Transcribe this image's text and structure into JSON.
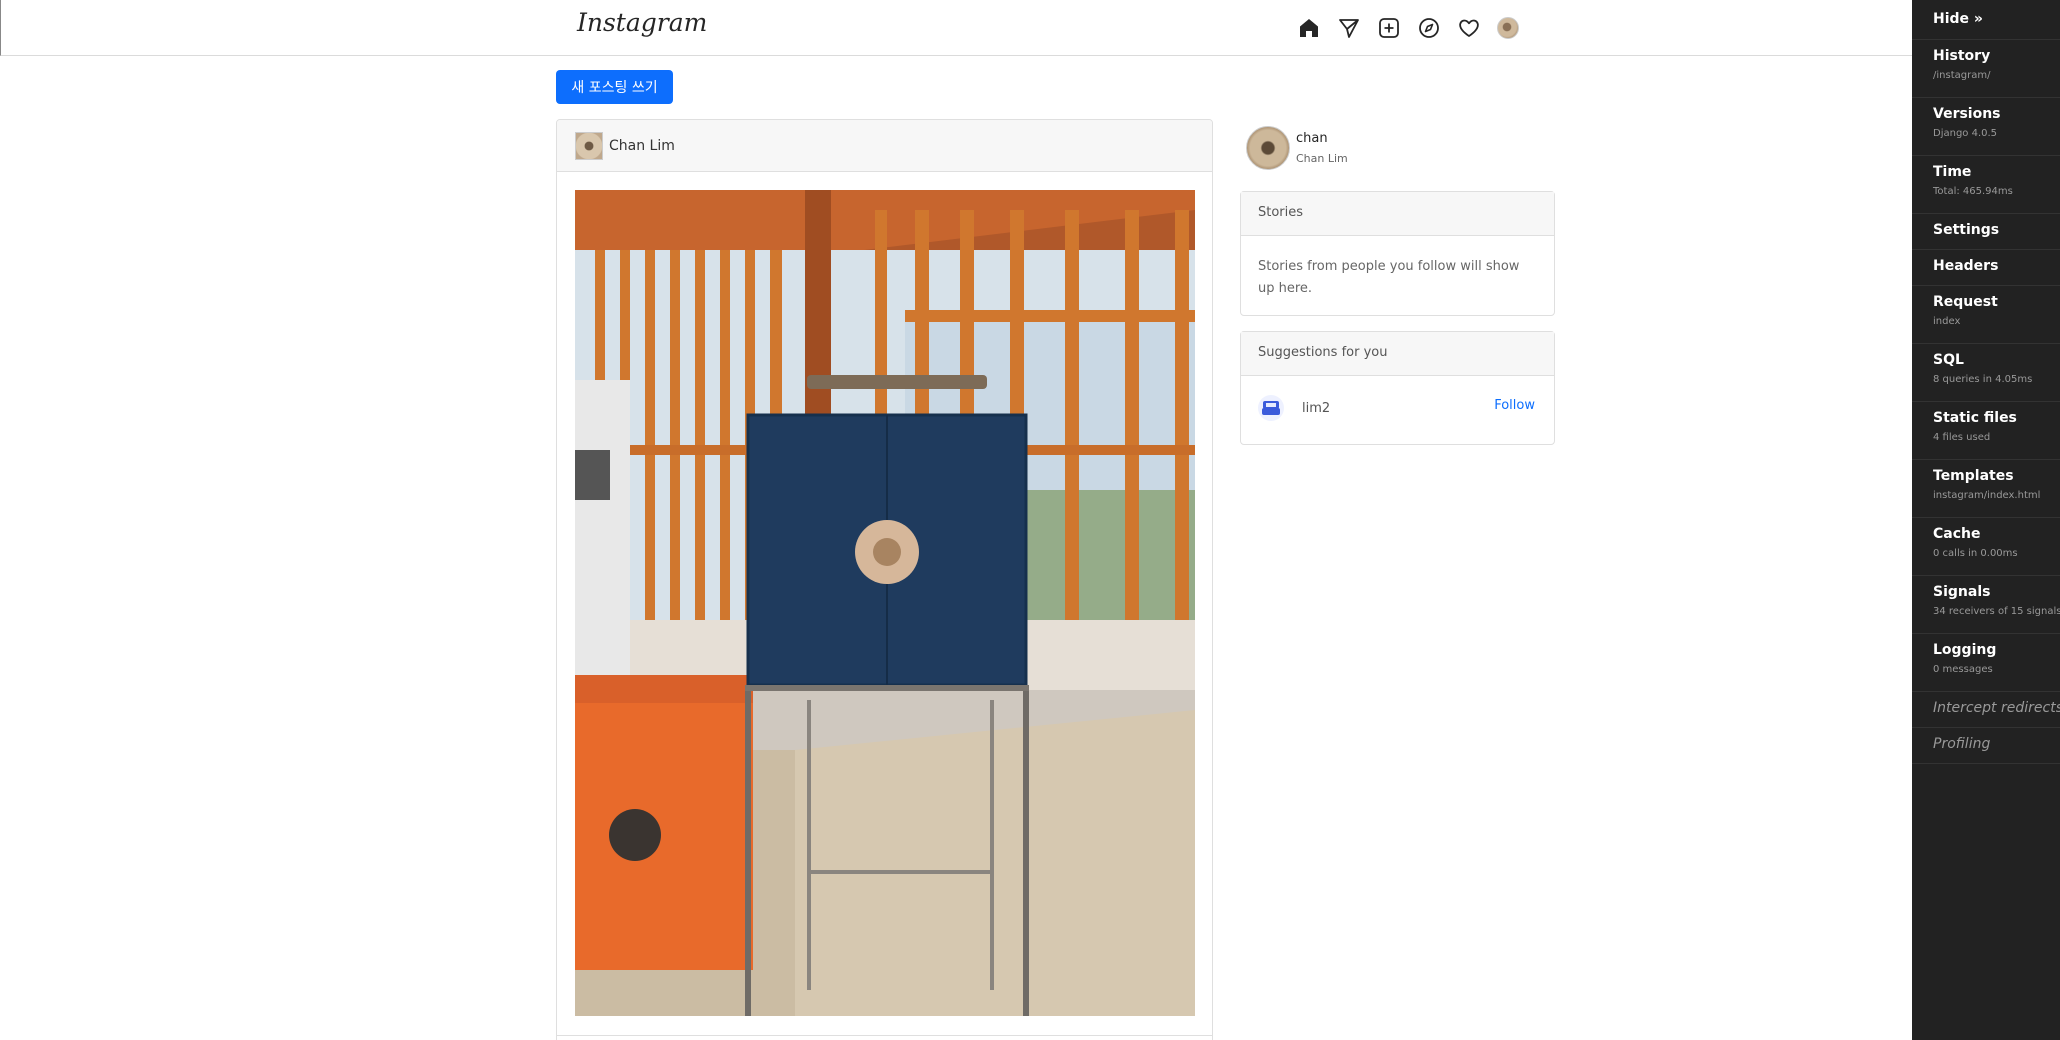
{
  "header": {
    "logo": "Instagram",
    "icons": [
      "home-icon",
      "send-icon",
      "add-post-icon",
      "explore-icon",
      "heart-icon",
      "avatar"
    ]
  },
  "actions": {
    "new_post_label": "새 포스팅 쓰기"
  },
  "post": {
    "author": "Chan Lim"
  },
  "sidebar": {
    "username": "chan",
    "full_name": "Chan Lim",
    "stories": {
      "title": "Stories",
      "body": "Stories from people you follow will show up here."
    },
    "suggestions": {
      "title": "Suggestions for you",
      "items": [
        {
          "username": "lim2",
          "action": "Follow"
        }
      ]
    }
  },
  "debug_toolbar": {
    "hide_label": "Hide »",
    "panels": [
      {
        "title": "History",
        "subtitle": "/instagram/"
      },
      {
        "title": "Versions",
        "subtitle": "Django 4.0.5"
      },
      {
        "title": "Time",
        "subtitle": "Total: 465.94ms"
      },
      {
        "title": "Settings",
        "subtitle": ""
      },
      {
        "title": "Headers",
        "subtitle": ""
      },
      {
        "title": "Request",
        "subtitle": "index"
      },
      {
        "title": "SQL",
        "subtitle": "8 queries in 4.05ms"
      },
      {
        "title": "Static files",
        "subtitle": "4 files used"
      },
      {
        "title": "Templates",
        "subtitle": "instagram/index.html"
      },
      {
        "title": "Cache",
        "subtitle": "0 calls in 0.00ms"
      },
      {
        "title": "Signals",
        "subtitle": "34 receivers of 15 signals"
      },
      {
        "title": "Logging",
        "subtitle": "0 messages"
      },
      {
        "title": "Intercept redirects",
        "subtitle": ""
      },
      {
        "title": "Profiling",
        "subtitle": ""
      }
    ]
  },
  "colors": {
    "primary": "#0d6efd",
    "toolbar_bg": "#222222",
    "card_header_bg": "#f7f7f7"
  }
}
